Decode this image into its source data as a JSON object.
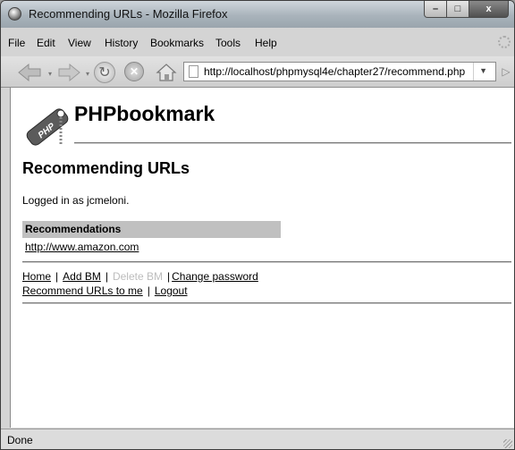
{
  "window": {
    "title": "Recommending URLs - Mozilla Firefox",
    "minimize": "–",
    "maximize": "□",
    "close": "x"
  },
  "menu": [
    "File",
    "Edit",
    "View",
    "History",
    "Bookmarks",
    "Tools",
    "Help"
  ],
  "nav": {
    "url": "http://localhost/phpmysql4e/chapter27/recommend.php"
  },
  "page": {
    "logo_text": "PHP",
    "site_title": "PHPbookmark",
    "heading": "Recommending URLs",
    "logged_in": "Logged in as jcmeloni.",
    "table_header": "Recommendations",
    "recommendations": [
      "http://www.amazon.com"
    ],
    "footer": {
      "home": "Home",
      "add_bm": "Add BM",
      "delete_bm": "Delete BM",
      "change_password": "Change password",
      "recommend": "Recommend URLs to me",
      "logout": "Logout"
    }
  },
  "status": "Done",
  "icons": {
    "back": "back-arrow-icon",
    "forward": "forward-arrow-icon",
    "reload": "reload-icon",
    "stop": "stop-icon",
    "home": "home-icon",
    "page": "page-icon",
    "go": "go-arrow-icon"
  },
  "colors": {
    "titlebar": "#a9b3bb",
    "table_header": "#c0c0c0",
    "disabled_link": "#bdbdbd"
  }
}
